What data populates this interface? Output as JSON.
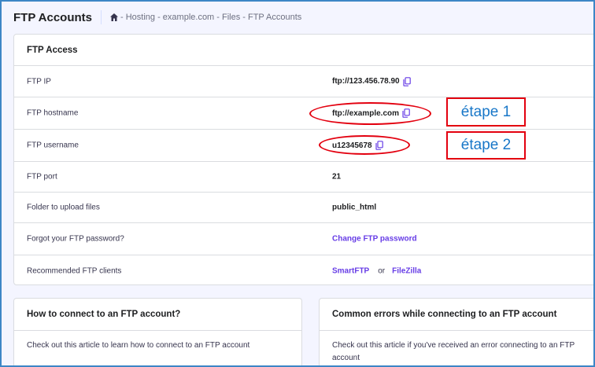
{
  "header": {
    "title": "FTP Accounts",
    "breadcrumb": {
      "home_icon": "home-icon",
      "text": "- Hosting - example.com - Files - FTP Accounts"
    }
  },
  "ftp_access": {
    "title": "FTP Access",
    "rows": [
      {
        "label": "FTP IP",
        "value": "ftp://123.456.78.90",
        "copy_icon": "copy-icon"
      },
      {
        "label": "FTP hostname",
        "value": "ftp://example.com",
        "copy_icon": "copy-icon"
      },
      {
        "label": "FTP username",
        "value": "u12345678",
        "copy_icon": "copy-icon"
      },
      {
        "label": "FTP port",
        "value": "21"
      },
      {
        "label": "Folder to upload files",
        "value": "public_html"
      },
      {
        "label": "Forgot your FTP password?",
        "link": "Change FTP password"
      },
      {
        "label": "Recommended FTP clients",
        "link1": "SmartFTP",
        "or": "or",
        "link2": "FileZilla"
      }
    ]
  },
  "annotations": {
    "step1": "étape 1",
    "step2": "étape 2",
    "highlight_color": "#e3000f",
    "step_text_color": "#1877c8"
  },
  "how_to_connect": {
    "title": "How to connect to an FTP account?",
    "description": "Check out this article to learn how to connect to an FTP account"
  },
  "common_errors": {
    "title": "Common errors while connecting to an FTP account",
    "description": "Check out this article if you've received an error connecting to an FTP account"
  },
  "colors": {
    "accent": "#673de6",
    "background": "#f4f5ff",
    "frame_border": "#3d86c6"
  }
}
